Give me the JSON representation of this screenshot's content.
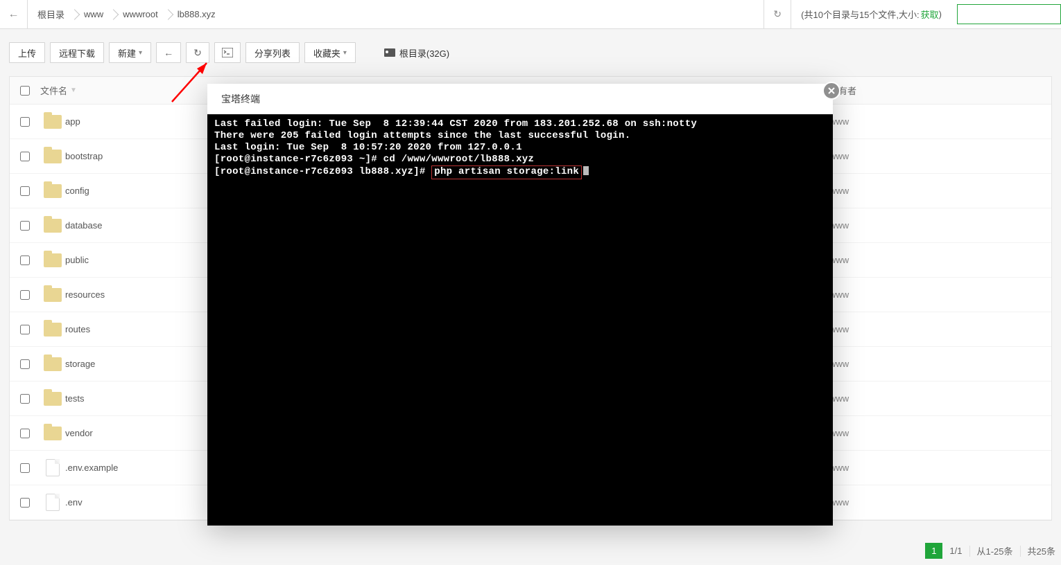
{
  "breadcrumbs": [
    "根目录",
    "www",
    "wwwroot",
    "lb888.xyz"
  ],
  "status": {
    "prefix": "(共10个目录与15个文件,大小:",
    "link": "获取",
    "suffix": ")"
  },
  "toolbar": {
    "upload": "上传",
    "remote": "远程下载",
    "new": "新建",
    "share": "分享列表",
    "fav": "收藏夹",
    "drive": "根目录(32G)"
  },
  "table": {
    "name_header": "文件名",
    "owner_header": "所有者",
    "rows": [
      {
        "type": "folder",
        "name": "app",
        "owner": "www"
      },
      {
        "type": "folder",
        "name": "bootstrap",
        "owner": "www"
      },
      {
        "type": "folder",
        "name": "config",
        "owner": "www"
      },
      {
        "type": "folder",
        "name": "database",
        "owner": "www"
      },
      {
        "type": "folder",
        "name": "public",
        "owner": "www"
      },
      {
        "type": "folder",
        "name": "resources",
        "owner": "www"
      },
      {
        "type": "folder",
        "name": "routes",
        "owner": "www"
      },
      {
        "type": "folder",
        "name": "storage",
        "owner": "www"
      },
      {
        "type": "folder",
        "name": "tests",
        "owner": "www"
      },
      {
        "type": "folder",
        "name": "vendor",
        "owner": "www"
      },
      {
        "type": "file",
        "name": ".env.example",
        "owner": "www"
      },
      {
        "type": "file",
        "name": ".env",
        "owner": "www"
      }
    ]
  },
  "pager": {
    "current": "1",
    "pages": "1/1",
    "range": "从1-25条",
    "total": "共25条"
  },
  "modal": {
    "title": "宝塔终端",
    "lines": [
      "Last failed login: Tue Sep  8 12:39:44 CST 2020 from 183.201.252.68 on ssh:notty",
      "There were 205 failed login attempts since the last successful login.",
      "Last login: Tue Sep  8 10:57:20 2020 from 127.0.0.1",
      "[root@instance-r7c6z093 ~]# cd /www/wwwroot/lb888.xyz"
    ],
    "prompt": "[root@instance-r7c6z093 lb888.xyz]#",
    "highlight": "php artisan storage:link"
  }
}
